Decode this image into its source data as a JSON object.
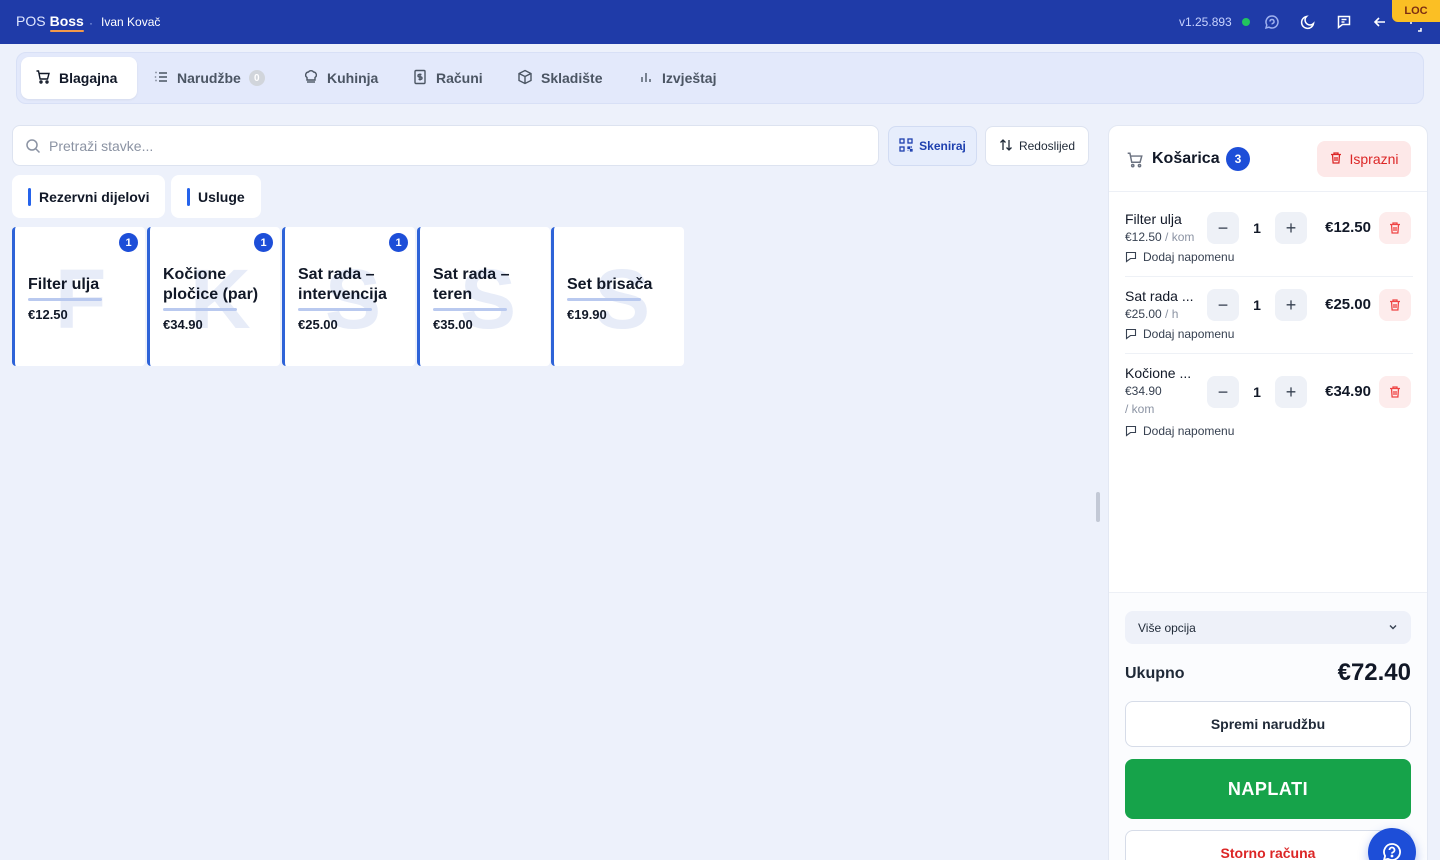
{
  "topbar": {
    "brand_pos": "POS",
    "brand_boss": "Boss",
    "separator": "·",
    "user": "Ivan Kovač",
    "version": "v1.25.893",
    "env_badge": "LOC",
    "icons": [
      "chat-icon",
      "moon-icon",
      "message-icon",
      "back-arrow-icon",
      "expand-icon"
    ]
  },
  "tabs": [
    {
      "label": "Blagajna",
      "icon": "cart-icon",
      "active": true
    },
    {
      "label": "Narudžbe",
      "icon": "list-icon",
      "badge": "0"
    },
    {
      "label": "Kuhinja",
      "icon": "chef-hat-icon"
    },
    {
      "label": "Računi",
      "icon": "receipt-icon"
    },
    {
      "label": "Skladište",
      "icon": "box-icon"
    },
    {
      "label": "Izvještaj",
      "icon": "bar-chart-icon"
    }
  ],
  "search": {
    "placeholder": "Pretraži stavke..."
  },
  "toolbar": {
    "scan_label": "Skeniraj",
    "sort_label": "Redoslijed"
  },
  "categories": [
    "Rezervni dijelovi",
    "Usluge"
  ],
  "products": [
    {
      "name": "Filter ulja",
      "price": "€12.50",
      "letter": "F",
      "badge": "1"
    },
    {
      "name": "Kočione pločice (par)",
      "price": "€34.90",
      "letter": "K",
      "badge": "1"
    },
    {
      "name": "Sat rada – intervencija",
      "price": "€25.00",
      "letter": "S",
      "badge": "1"
    },
    {
      "name": "Sat rada – teren",
      "price": "€35.00",
      "letter": "S",
      "badge": ""
    },
    {
      "name": "Set brisača",
      "price": "€19.90",
      "letter": "S",
      "badge": ""
    }
  ],
  "cart": {
    "title": "Košarica",
    "count": "3",
    "clear_label": "Isprazni",
    "items": [
      {
        "name": "Filter ulja",
        "unit_price": "€12.50",
        "unit": " / kom",
        "qty": "1",
        "total": "€12.50",
        "note_label": "Dodaj napomenu"
      },
      {
        "name": "Sat rada ...",
        "unit_price": "€25.00",
        "unit": " / h",
        "qty": "1",
        "total": "€25.00",
        "note_label": "Dodaj napomenu"
      },
      {
        "name": "Kočione ...",
        "unit_price": "€34.90",
        "unit": "/ kom",
        "qty": "1",
        "total": "€34.90",
        "note_label": "Dodaj napomenu"
      }
    ],
    "options_label": "Više opcija",
    "total_label": "Ukupno",
    "total_value": "€72.40",
    "save_label": "Spremi narudžbu",
    "pay_label": "NAPLATI",
    "storno_label": "Storno računa"
  },
  "colors": {
    "topbar": "#1f3ba8",
    "accent": "#1d4ed8",
    "pay": "#16a34a",
    "danger": "#dc2626",
    "background": "#edf1fb"
  }
}
